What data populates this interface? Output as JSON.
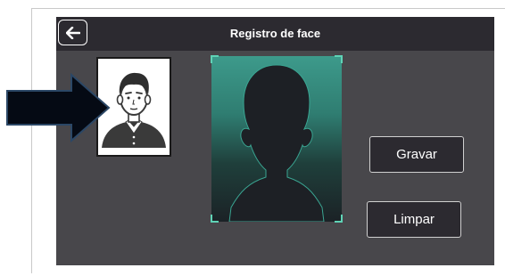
{
  "header": {
    "title": "Registro de face"
  },
  "buttons": {
    "record_label": "Gravar",
    "clear_label": "Limpar"
  },
  "icons": {
    "back": "arrow-left-icon",
    "user": "user-avatar-icon",
    "silhouette": "face-silhouette-icon",
    "pointer": "arrow-right-icon"
  },
  "colors": {
    "panel_bg": "#48474b",
    "titlebar_bg": "#2c2a30",
    "preview_accent": "#5fd3b6"
  }
}
